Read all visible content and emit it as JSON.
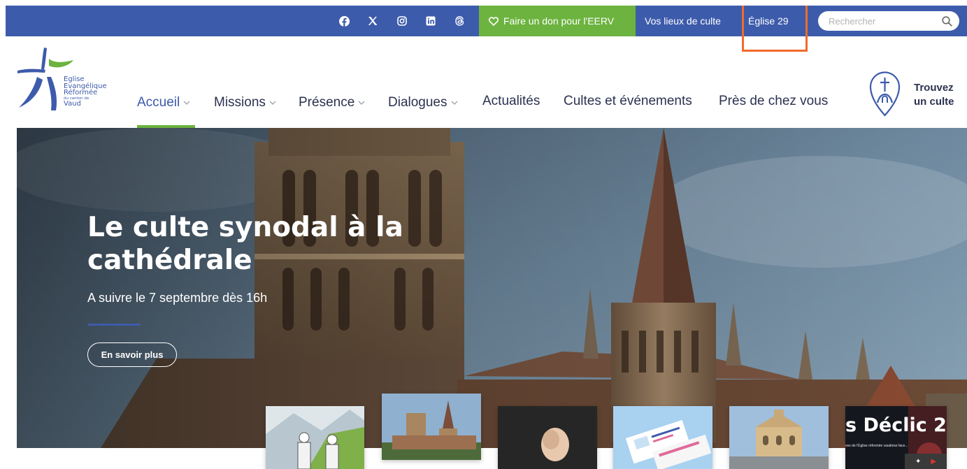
{
  "topbar": {
    "social_icons": [
      "facebook-icon",
      "x-icon",
      "instagram-icon",
      "linkedin-icon",
      "threads-icon"
    ],
    "donate_label": "Faire un don pour l'EERV",
    "link_places": "Vos lieux de culte",
    "link_church": "Église 29",
    "search_placeholder": "Rechercher"
  },
  "logo": {
    "line1": "Eglise",
    "line2": "Evangélique",
    "line3": "Réformée",
    "line4": "du canton de",
    "line5": "Vaud"
  },
  "nav": {
    "items": [
      {
        "label": "Accueil",
        "dropdown": true,
        "active": true
      },
      {
        "label": "Missions",
        "dropdown": true
      },
      {
        "label": "Présence",
        "dropdown": true
      },
      {
        "label": "Dialogues",
        "dropdown": true
      },
      {
        "label": "Actualités",
        "dropdown": false
      },
      {
        "label": "Cultes et événements",
        "dropdown": false
      },
      {
        "label": "Près de chez vous",
        "dropdown": false
      }
    ],
    "find_line1": "Trouvez",
    "find_line2": "un culte"
  },
  "hero": {
    "title_line1": "Le culte synodal à la",
    "title_line2": "cathédrale",
    "subtitle": "A suivre le 7 septembre dès 16h",
    "button_label": "En savoir plus"
  },
  "strip": {
    "declic_title": "s Déclic 2",
    "declic_caption": "ves de l'Église réformée vaudoise face..."
  },
  "colors": {
    "brand_blue": "#3d5bab",
    "brand_green": "#6cb33f",
    "highlight_orange": "#f26b2a"
  }
}
